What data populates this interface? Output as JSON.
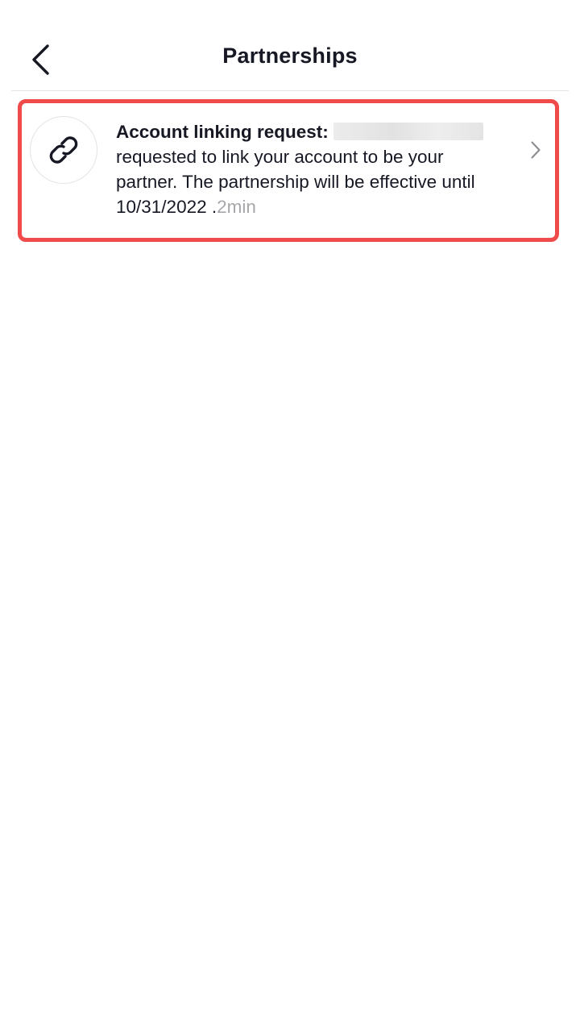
{
  "header": {
    "title": "Partnerships",
    "back_icon": "chevron-left-icon"
  },
  "notification": {
    "icon": "link-icon",
    "title": "Account linking request:",
    "message": "requested to link your account to be your partner. The partnership will be effective until 10/31/2022 .",
    "time": "2min",
    "chevron_icon": "chevron-right-icon"
  },
  "colors": {
    "highlight_border": "#ef4b4b",
    "text_primary": "#161823",
    "text_secondary": "#a7a7ab"
  }
}
